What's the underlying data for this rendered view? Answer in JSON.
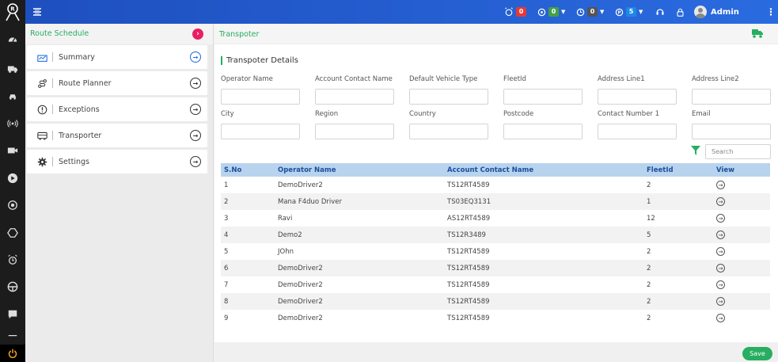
{
  "topbar": {
    "alarm_count": "0",
    "online_count": "0",
    "idle_count": "0",
    "parked_count": "5",
    "user_name": "Admin",
    "colors": {
      "alarm": "#e53935",
      "online": "#43a047",
      "idle": "#555555",
      "parked": "#1e88e5"
    }
  },
  "subnav": {
    "title": "Route Schedule",
    "items": [
      {
        "label": "Summary",
        "icon": "summary-icon"
      },
      {
        "label": "Route Planner",
        "icon": "route-planner-icon"
      },
      {
        "label": "Exceptions",
        "icon": "exclamation-icon"
      },
      {
        "label": "Transporter",
        "icon": "bus-icon"
      },
      {
        "label": "Settings",
        "icon": "gear-icon"
      }
    ]
  },
  "main": {
    "title": "Transpoter",
    "section_title": "Transpoter Details",
    "fields": [
      {
        "label": "Operator Name",
        "value": ""
      },
      {
        "label": "Account Contact Name",
        "value": ""
      },
      {
        "label": "Default Vehicle Type",
        "value": ""
      },
      {
        "label": "FleetId",
        "value": ""
      },
      {
        "label": "Address Line1",
        "value": ""
      },
      {
        "label": "Address Line2",
        "value": ""
      },
      {
        "label": "City",
        "value": ""
      },
      {
        "label": "Region",
        "value": ""
      },
      {
        "label": "Country",
        "value": ""
      },
      {
        "label": "Postcode",
        "value": ""
      },
      {
        "label": "Contact Number 1",
        "value": ""
      },
      {
        "label": "Email",
        "value": ""
      }
    ],
    "search_placeholder": "Search",
    "table": {
      "headers": [
        "S.No",
        "Operator Name",
        "Account Contact Name",
        "FleetId",
        "View"
      ],
      "rows": [
        [
          "1",
          "DemoDriver2",
          "TS12RT4589",
          "2"
        ],
        [
          "2",
          "Mana F4duo Driver",
          "TS03EQ3131",
          "1"
        ],
        [
          "3",
          "Ravi",
          "AS12RT4589",
          "12"
        ],
        [
          "4",
          "Demo2",
          "TS12R3489",
          "5"
        ],
        [
          "5",
          "JOhn",
          "TS12RT4589",
          "2"
        ],
        [
          "6",
          "DemoDriver2",
          "TS12RT4589",
          "2"
        ],
        [
          "7",
          "DemoDriver2",
          "TS12RT4589",
          "2"
        ],
        [
          "8",
          "DemoDriver2",
          "TS12RT4589",
          "2"
        ],
        [
          "9",
          "DemoDriver2",
          "TS12RT4589",
          "2"
        ]
      ]
    },
    "save_label": "Save"
  }
}
